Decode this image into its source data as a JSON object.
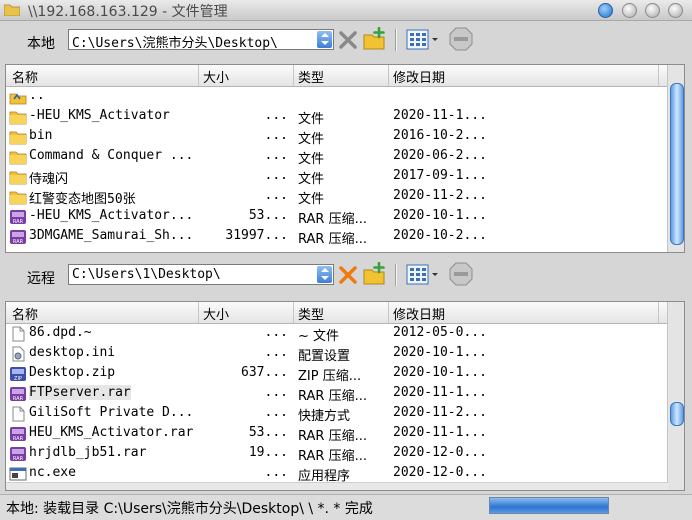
{
  "window": {
    "title": "\\\\192.168.163.129 - 文件管理"
  },
  "columns": {
    "name": "名称",
    "size": "大小",
    "type": "类型",
    "date": "修改日期"
  },
  "local": {
    "label": "本地",
    "path": "C:\\Users\\浣熊市分头\\Desktop\\",
    "rows": [
      {
        "icon": "up-folder-icon",
        "name": "..",
        "size": "",
        "type": "",
        "date": ""
      },
      {
        "icon": "folder-icon",
        "name": "-HEU_KMS_Activator",
        "size": "...",
        "type": "文件",
        "date": "2020-11-1..."
      },
      {
        "icon": "folder-icon",
        "name": "bin",
        "size": "...",
        "type": "文件",
        "date": "2016-10-2..."
      },
      {
        "icon": "folder-icon",
        "name": "Command & Conquer ...",
        "size": "...",
        "type": "文件",
        "date": "2020-06-2..."
      },
      {
        "icon": "folder-icon",
        "name": "侍魂闪",
        "size": "...",
        "type": "文件",
        "date": "2017-09-1..."
      },
      {
        "icon": "folder-icon",
        "name": "红警变态地图50张",
        "size": "...",
        "type": "文件",
        "date": "2020-11-2..."
      },
      {
        "icon": "rar-icon",
        "name": "-HEU_KMS_Activator...",
        "size": "53...",
        "type": "RAR 压缩...",
        "date": "2020-10-1..."
      },
      {
        "icon": "rar-icon",
        "name": "3DMGAME_Samurai_Sh...",
        "size": "31997...",
        "type": "RAR 压缩...",
        "date": "2020-10-2..."
      }
    ]
  },
  "remote": {
    "label": "远程",
    "path": "C:\\Users\\1\\Desktop\\",
    "rows": [
      {
        "icon": "file-icon",
        "name": "86.dpd.~",
        "size": "...",
        "type": "~ 文件",
        "date": "2012-05-0..."
      },
      {
        "icon": "settings-file-icon",
        "name": "desktop.ini",
        "size": "...",
        "type": "配置设置",
        "date": "2020-10-1..."
      },
      {
        "icon": "zip-icon",
        "name": "Desktop.zip",
        "size": "637...",
        "type": "ZIP 压缩...",
        "date": "2020-10-1..."
      },
      {
        "icon": "rar-icon",
        "name": "FTPserver.rar",
        "size": "...",
        "type": "RAR 压缩...",
        "date": "2020-11-1..."
      },
      {
        "icon": "file-icon",
        "name": "GiliSoft Private D...",
        "size": "...",
        "type": "快捷方式",
        "date": "2020-11-2..."
      },
      {
        "icon": "rar-icon",
        "name": "HEU_KMS_Activator.rar",
        "size": "53...",
        "type": "RAR 压缩...",
        "date": "2020-11-1..."
      },
      {
        "icon": "rar-icon",
        "name": "hrjdlb_jb51.rar",
        "size": "19...",
        "type": "RAR 压缩...",
        "date": "2020-12-0..."
      },
      {
        "icon": "exe-icon",
        "name": "nc.exe",
        "size": "...",
        "type": "应用程序",
        "date": "2020-12-0..."
      }
    ]
  },
  "status": {
    "text": "本地: 装载目录 C:\\Users\\浣熊市分头\\Desktop\\ \\ *. * 完成",
    "progress": 1.0
  },
  "colors": {
    "accent": "#2d74d2",
    "folder": "#f2c232",
    "rar": "#7a3da6"
  }
}
